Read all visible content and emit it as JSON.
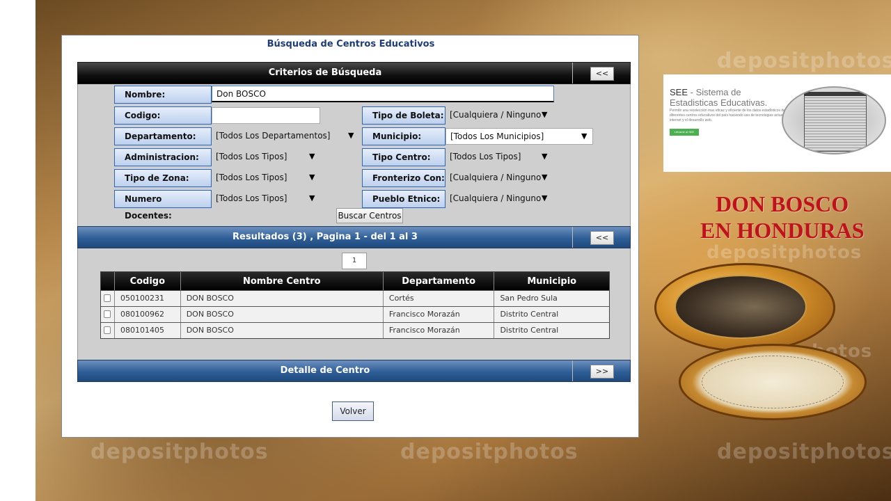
{
  "app": {
    "page_title": "Búsqueda de Centros Educativos"
  },
  "criteria": {
    "section_title": "Criterios de Búsqueda",
    "collapse_label": "<<",
    "fields": {
      "nombre": {
        "label": "Nombre:",
        "value": "Don BOSCO"
      },
      "codigo": {
        "label": "Codigo:",
        "value": ""
      },
      "tipo_boleta": {
        "label": "Tipo de Boleta:",
        "value": "[Cualquiera / Ninguno"
      },
      "departamento": {
        "label": "Departamento:",
        "value": "[Todos Los Departamentos]"
      },
      "municipio": {
        "label": "Municipio:",
        "value": "[Todos Los Municipios]"
      },
      "administracion": {
        "label": "Administracion:",
        "value": "[Todos Los Tipos]"
      },
      "tipo_centro": {
        "label": "Tipo Centro:",
        "value": "[Todos Los Tipos]"
      },
      "tipo_zona": {
        "label": "Tipo de Zona:",
        "value": "[Todos Los Tipos]"
      },
      "fronterizo": {
        "label": "Fronterizo Con:",
        "value": "[Cualquiera / Ninguno"
      },
      "numero_docentes": {
        "label": "Numero Docentes:",
        "value": "[Todos Los Tipos]"
      },
      "pueblo_etnico": {
        "label": "Pueblo Etnico:",
        "value": "[Cualquiera / Ninguno"
      }
    },
    "search_button": "Buscar Centros"
  },
  "results": {
    "section_title": "Resultados (3) , Pagina 1 - del 1 al 3",
    "collapse_label": "<<",
    "page_number": "1",
    "columns": [
      "Codigo",
      "Nombre Centro",
      "Departamento",
      "Municipio"
    ],
    "rows": [
      [
        "050100231",
        "DON BOSCO",
        "Cortés",
        "San Pedro Sula"
      ],
      [
        "080100962",
        "DON BOSCO",
        "Francisco Morazán",
        "Distrito Central"
      ],
      [
        "080101405",
        "DON BOSCO",
        "Francisco Morazán",
        "Distrito Central"
      ]
    ]
  },
  "detail": {
    "section_title": "Detalle de Centro",
    "expand_label": ">>"
  },
  "back_button": "Volver",
  "see_card": {
    "abbr": "SEE",
    "title_rest": " - Sistema de Estadisticas Educativas.",
    "description": "Permitir una recolección mas eficaz y eficiente de los datos estadísticos de los diferentes centros educativos del país haciendo uso de tecnologias actuales como el internet y el desarrollo web.",
    "button": "Llévame al SEE"
  },
  "headline": {
    "line1": "DON BOSCO",
    "line2": "EN HONDURAS"
  },
  "watermark": "depositphotos",
  "colors": {
    "headline_red": "#c0121c",
    "label_border_blue": "#2c64b8",
    "title_blue": "#1f3b7a",
    "see_button_green": "#4caf50"
  },
  "icons": {
    "dropdown": "triangle-down"
  }
}
